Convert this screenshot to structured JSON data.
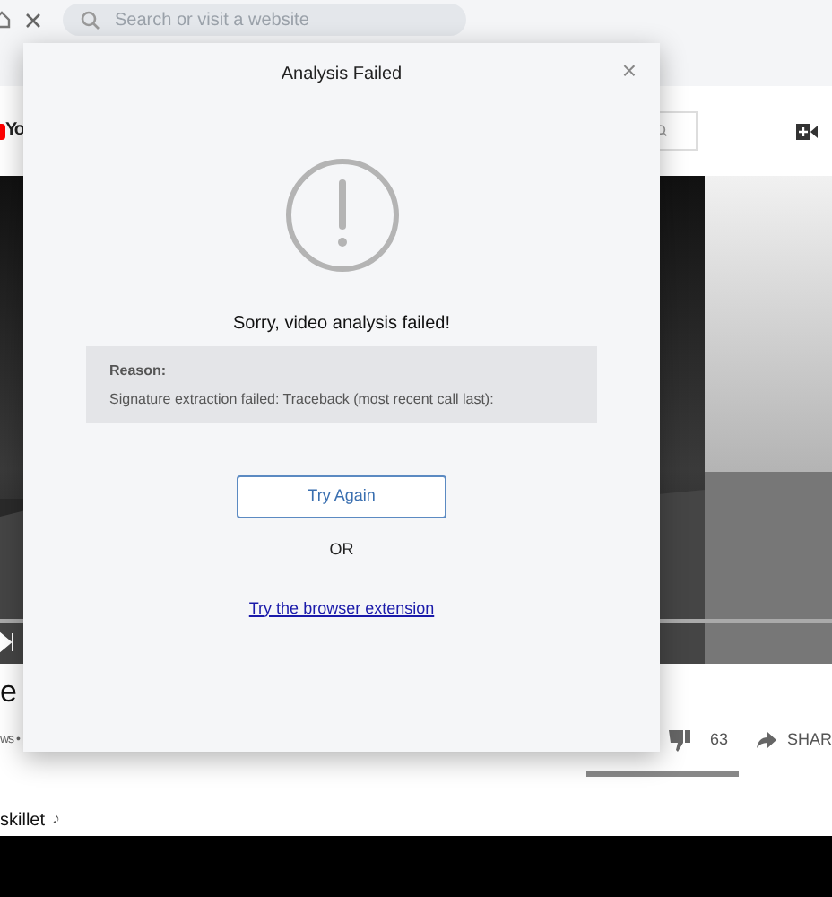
{
  "browser": {
    "search": {
      "placeholder": "Search or visit a website"
    }
  },
  "page": {
    "logo_text": "Yo",
    "title": "e",
    "meta": "ws •",
    "dislikes": "63",
    "share": "SHAR",
    "channel": "skillet",
    "note": "♪"
  },
  "dialog": {
    "title": "Analysis Failed",
    "close": "×",
    "message": "Sorry, video analysis failed!",
    "reason_label": "Reason:",
    "reason": "Signature extraction failed: Traceback (most recent call last):",
    "retry": "Try Again",
    "or": "OR",
    "link": "Try the browser extension"
  }
}
